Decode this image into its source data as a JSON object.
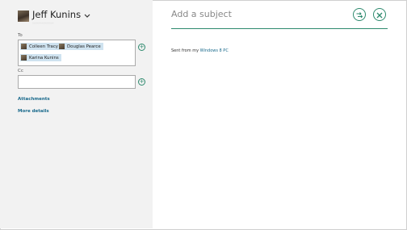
{
  "sender": {
    "name": "Jeff Kunins",
    "email_obscured": "··············"
  },
  "to_field": {
    "label": "To",
    "recipients": [
      "Colleen Tracy",
      "Douglas Pearce",
      "Karina Kunins"
    ]
  },
  "cc_field": {
    "label": "Cc",
    "value": ""
  },
  "links": {
    "attachments": "Attachments",
    "more_details": "More details"
  },
  "subject": {
    "placeholder": "Add a subject"
  },
  "body": {
    "signature_prefix": "Sent from my",
    "signature_link": "Windows 8 PC"
  },
  "colors": {
    "accent": "#2e8a6e",
    "link": "#1a6a8c",
    "left_pane_bg": "#f2f2f2",
    "chip_bg": "#cfe3f0"
  },
  "icons": {
    "send": "send-icon",
    "close": "close-icon",
    "add": "add-icon",
    "chevron": "chevron-down-icon"
  }
}
